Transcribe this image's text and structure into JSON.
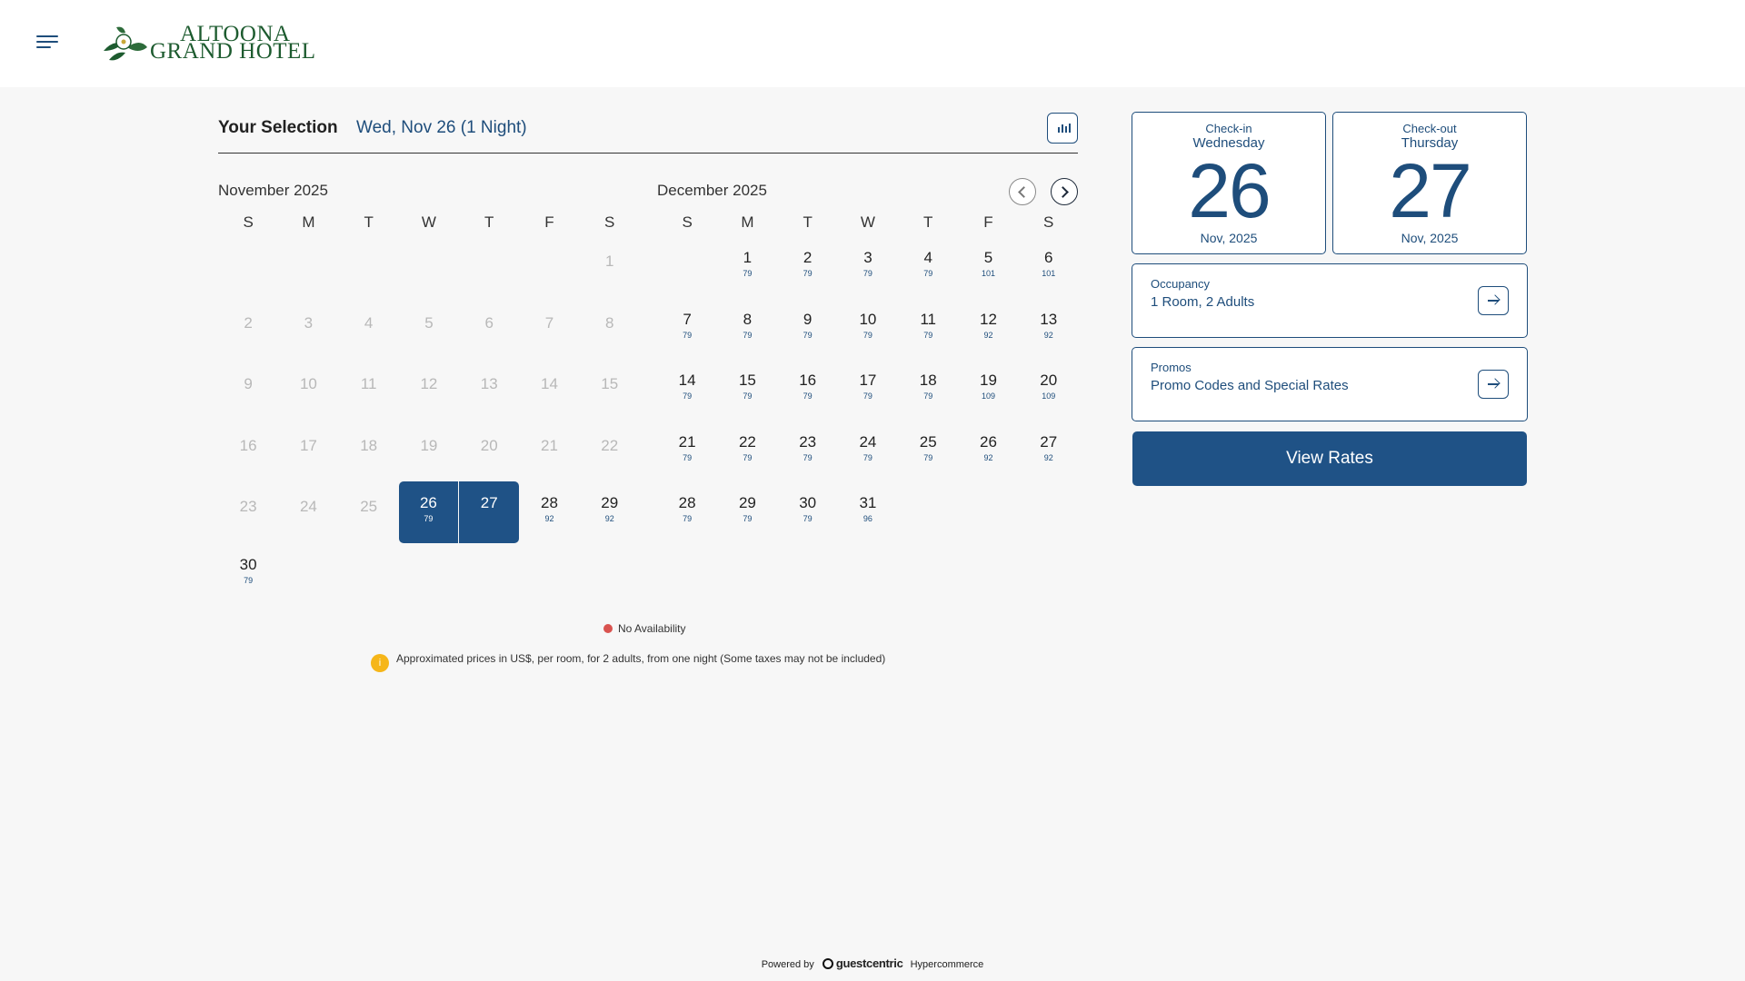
{
  "header": {
    "brand_line1": "ALTOONA",
    "brand_line2": "GRAND HOTEL"
  },
  "selection": {
    "label": "Your Selection",
    "value": "Wed, Nov 26 (1 Night)"
  },
  "calendar": {
    "weekday_headers": [
      "S",
      "M",
      "T",
      "W",
      "T",
      "F",
      "S"
    ],
    "months": [
      {
        "title": "November 2025",
        "weeks": [
          [
            null,
            null,
            null,
            null,
            null,
            null,
            {
              "day": "1",
              "disabled": true
            }
          ],
          [
            {
              "day": "2",
              "disabled": true
            },
            {
              "day": "3",
              "disabled": true
            },
            {
              "day": "4",
              "disabled": true
            },
            {
              "day": "5",
              "disabled": true
            },
            {
              "day": "6",
              "disabled": true
            },
            {
              "day": "7",
              "disabled": true
            },
            {
              "day": "8",
              "disabled": true
            }
          ],
          [
            {
              "day": "9",
              "disabled": true
            },
            {
              "day": "10",
              "disabled": true
            },
            {
              "day": "11",
              "disabled": true
            },
            {
              "day": "12",
              "disabled": true
            },
            {
              "day": "13",
              "disabled": true
            },
            {
              "day": "14",
              "disabled": true
            },
            {
              "day": "15",
              "disabled": true
            }
          ],
          [
            {
              "day": "16",
              "disabled": true
            },
            {
              "day": "17",
              "disabled": true
            },
            {
              "day": "18",
              "disabled": true
            },
            {
              "day": "19",
              "disabled": true
            },
            {
              "day": "20",
              "disabled": true
            },
            {
              "day": "21",
              "disabled": true
            },
            {
              "day": "22",
              "disabled": true
            }
          ],
          [
            {
              "day": "23",
              "disabled": true
            },
            {
              "day": "24",
              "disabled": true
            },
            {
              "day": "25",
              "disabled": true
            },
            {
              "day": "26",
              "price": "79",
              "selected": "start"
            },
            {
              "day": "27",
              "price": "",
              "selected": "end"
            },
            {
              "day": "28",
              "price": "92"
            },
            {
              "day": "29",
              "price": "92"
            }
          ],
          [
            {
              "day": "30",
              "price": "79"
            },
            null,
            null,
            null,
            null,
            null,
            null
          ]
        ]
      },
      {
        "title": "December 2025",
        "weeks": [
          [
            null,
            {
              "day": "1",
              "price": "79"
            },
            {
              "day": "2",
              "price": "79"
            },
            {
              "day": "3",
              "price": "79"
            },
            {
              "day": "4",
              "price": "79"
            },
            {
              "day": "5",
              "price": "101"
            },
            {
              "day": "6",
              "price": "101"
            }
          ],
          [
            {
              "day": "7",
              "price": "79"
            },
            {
              "day": "8",
              "price": "79"
            },
            {
              "day": "9",
              "price": "79"
            },
            {
              "day": "10",
              "price": "79"
            },
            {
              "day": "11",
              "price": "79"
            },
            {
              "day": "12",
              "price": "92"
            },
            {
              "day": "13",
              "price": "92"
            }
          ],
          [
            {
              "day": "14",
              "price": "79"
            },
            {
              "day": "15",
              "price": "79"
            },
            {
              "day": "16",
              "price": "79"
            },
            {
              "day": "17",
              "price": "79"
            },
            {
              "day": "18",
              "price": "79"
            },
            {
              "day": "19",
              "price": "109"
            },
            {
              "day": "20",
              "price": "109"
            }
          ],
          [
            {
              "day": "21",
              "price": "79"
            },
            {
              "day": "22",
              "price": "79"
            },
            {
              "day": "23",
              "price": "79"
            },
            {
              "day": "24",
              "price": "79"
            },
            {
              "day": "25",
              "price": "79"
            },
            {
              "day": "26",
              "price": "92"
            },
            {
              "day": "27",
              "price": "92"
            }
          ],
          [
            {
              "day": "28",
              "price": "79"
            },
            {
              "day": "29",
              "price": "79"
            },
            {
              "day": "30",
              "price": "79"
            },
            {
              "day": "31",
              "price": "96"
            },
            null,
            null,
            null
          ]
        ]
      }
    ]
  },
  "legend": {
    "no_availability": "No Availability",
    "note_icon": "i",
    "note": "Approximated prices in US$, per room, for 2 adults, from one night (Some taxes may not be included)"
  },
  "booking": {
    "checkin": {
      "label": "Check-in",
      "weekday": "Wednesday",
      "day": "26",
      "month_year": "Nov, 2025"
    },
    "checkout": {
      "label": "Check-out",
      "weekday": "Thursday",
      "day": "27",
      "month_year": "Nov, 2025"
    },
    "occupancy": {
      "label": "Occupancy",
      "value": "1 Room, 2 Adults"
    },
    "promos": {
      "label": "Promos",
      "value": "Promo Codes and Special Rates"
    },
    "view_rates": "View Rates"
  },
  "footer": {
    "powered_by": "Powered by",
    "provider": "guestcentric",
    "product": "Hypercommerce"
  },
  "colors": {
    "primary": "#1f5286",
    "text_blue": "#1e4d7b",
    "brand_green": "#1d5b2f",
    "no_availability_dot": "#d9534f",
    "info_icon": "#f6b619"
  }
}
